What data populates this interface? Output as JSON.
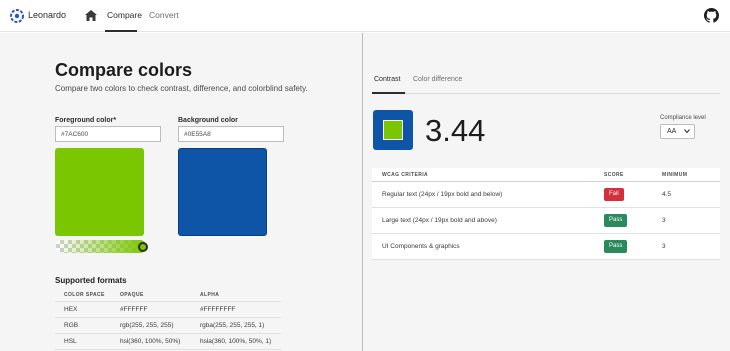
{
  "app": {
    "brand": "Leonardo"
  },
  "nav": {
    "compare": "Compare",
    "convert": "Convert"
  },
  "page": {
    "title": "Compare colors",
    "subtitle": "Compare two colors to check contrast, difference, and colorblind safety."
  },
  "foreground": {
    "label": "Foreground color*",
    "value": "#7AC600",
    "color": "#7AC600"
  },
  "background": {
    "label": "Background color",
    "value": "#0E55A8",
    "color": "#0E55A8"
  },
  "formats": {
    "title": "Supported formats",
    "headers": [
      "COLOR SPACE",
      "OPAQUE",
      "ALPHA"
    ],
    "rows": [
      [
        "HEX",
        "#FFFFFF",
        "#FFFFFFFF"
      ],
      [
        "RGB",
        "rgb(255, 255, 255)",
        "rgba(255, 255, 255, 1)"
      ],
      [
        "HSL",
        "hsl(360, 100%, 50%)",
        "hsla(360, 100%, 50%, 1)"
      ]
    ]
  },
  "tabs": {
    "contrast": "Contrast",
    "difference": "Color difference"
  },
  "contrast": {
    "ratio": "3.44"
  },
  "compliance": {
    "label": "Compliance level",
    "value": "AA"
  },
  "wcag": {
    "headers": [
      "WCAG CRITERIA",
      "SCORE",
      "MINIMUM"
    ],
    "rows": [
      {
        "criteria": "Regular text (24px / 19px bold and below)",
        "score": "Fail",
        "minimum": "4.5"
      },
      {
        "criteria": "Large text (24px / 19px bold and above)",
        "score": "Pass",
        "minimum": "3"
      },
      {
        "criteria": "UI Components & graphics",
        "score": "Pass",
        "minimum": "3"
      }
    ]
  },
  "colors": {
    "pass": "#2a8a5e",
    "fail": "#d1303c"
  },
  "icons": {
    "logo": "leonardo-logo-icon",
    "home": "home-icon",
    "github": "github-icon",
    "select": "chevron-down-icon"
  }
}
